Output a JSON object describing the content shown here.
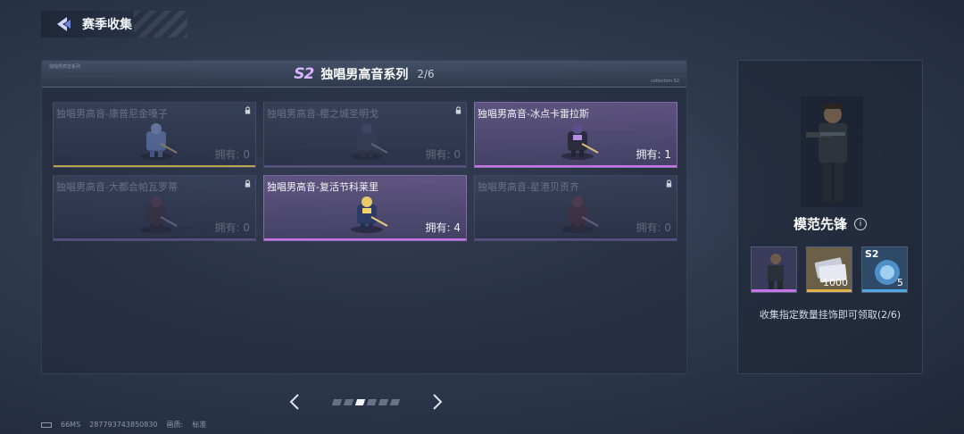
{
  "header": {
    "title": "赛季收集"
  },
  "panel": {
    "badge": "S2",
    "title": "独唱男高音系列",
    "count": "2/6",
    "tag_left": "独唱男高音系列",
    "tag_right": "collection S2"
  },
  "cards": [
    {
      "name": "独唱男高音-康普尼金嗓子",
      "count": "拥有: 0",
      "owned": false,
      "bar_color": "#b8a24a"
    },
    {
      "name": "独唱男高音-樱之城圣明戈",
      "count": "拥有: 0",
      "owned": false,
      "bar_color": "#9a72c9"
    },
    {
      "name": "独唱男高音-冰点卡雷拉斯",
      "count": "拥有: 1",
      "owned": true,
      "bar_color": "#c774e8"
    },
    {
      "name": "独唱男高音-大都会帕瓦罗蒂",
      "count": "拥有: 0",
      "owned": false,
      "bar_color": "#9a72c9"
    },
    {
      "name": "独唱男高音-复活节科莱里",
      "count": "拥有: 4",
      "owned": true,
      "bar_color": "#c774e8"
    },
    {
      "name": "独唱男高音-星港贝贡齐",
      "count": "拥有: 0",
      "owned": false,
      "bar_color": "#9a72c9"
    }
  ],
  "pager": {
    "pages": 6,
    "active_page": 3
  },
  "reward": {
    "name": "模范先锋",
    "info_icon": "i",
    "items": [
      {
        "tag": "",
        "qty": "",
        "bar_color": "#c774e8",
        "icon": "soldier-icon"
      },
      {
        "tag": "",
        "qty": "1000",
        "bar_color": "#e0b24a",
        "icon": "card-icon"
      },
      {
        "tag": "S2",
        "qty": "5",
        "bar_color": "#4fa6e0",
        "icon": "crystal-icon"
      }
    ],
    "hint": "收集指定数量挂饰即可领取(2/6)"
  },
  "status": {
    "ping": "66MS",
    "id": "287793743850830",
    "quality_label": "画质:",
    "quality_value": "标准"
  }
}
